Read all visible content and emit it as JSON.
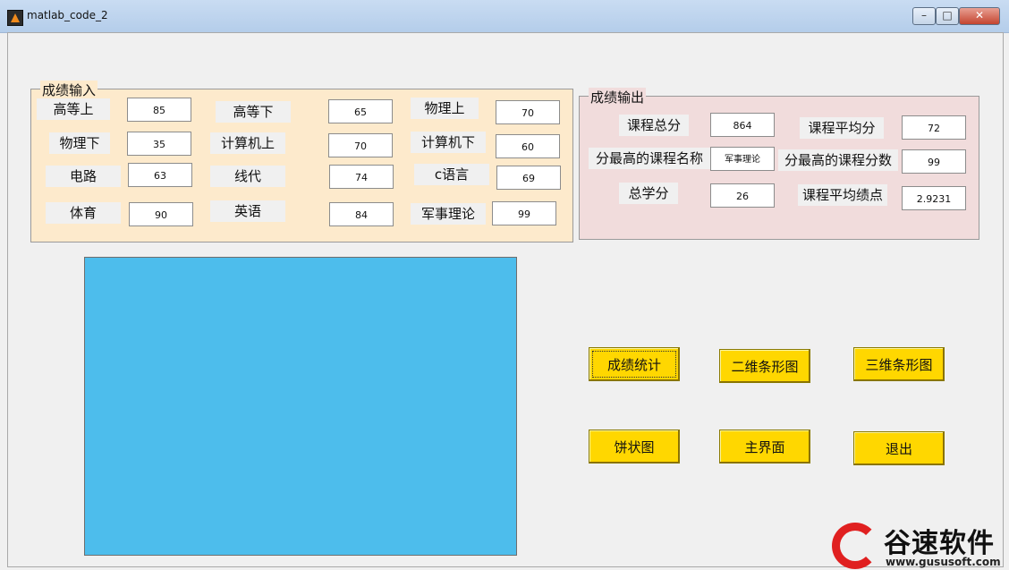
{
  "window": {
    "title": "matlab_code_2"
  },
  "input_panel": {
    "title": "成绩输入",
    "fields": [
      {
        "label": "高等上",
        "value": "85"
      },
      {
        "label": "高等下",
        "value": "65"
      },
      {
        "label": "物理上",
        "value": "70"
      },
      {
        "label": "物理下",
        "value": "35"
      },
      {
        "label": "计算机上",
        "value": "70"
      },
      {
        "label": "计算机下",
        "value": "60"
      },
      {
        "label": "电路",
        "value": "63"
      },
      {
        "label": "线代",
        "value": "74"
      },
      {
        "label": "c语言",
        "value": "69"
      },
      {
        "label": "体育",
        "value": "90"
      },
      {
        "label": "英语",
        "value": "84"
      },
      {
        "label": "军事理论",
        "value": "99"
      }
    ]
  },
  "output_panel": {
    "title": "成绩输出",
    "fields": [
      {
        "label": "课程总分",
        "value": "864"
      },
      {
        "label": "课程平均分",
        "value": "72"
      },
      {
        "label": "分最高的课程名称",
        "value": "军事理论"
      },
      {
        "label": "分最高的课程分数",
        "value": "99"
      },
      {
        "label": "总学分",
        "value": "26"
      },
      {
        "label": "课程平均绩点",
        "value": "2.9231"
      }
    ]
  },
  "buttons": {
    "stats": "成绩统计",
    "bar2d": "二维条形图",
    "bar3d": "三维条形图",
    "pie": "饼状图",
    "main": "主界面",
    "exit": "退出"
  },
  "watermark": {
    "name": "谷速软件",
    "url": "www.gususoft.com"
  },
  "colors": {
    "input_panel_bg": "#fdeacc",
    "output_panel_bg": "#f1dcdc",
    "plot_bg": "#4dbdec",
    "button_bg": "#ffd700"
  }
}
